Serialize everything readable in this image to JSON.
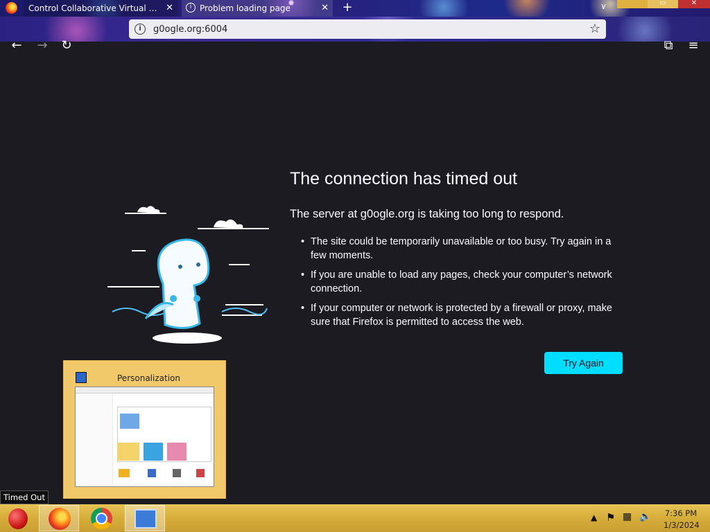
{
  "browser": {
    "tabs": [
      {
        "label": "Control Collaborative Virtual Machine",
        "close": "✕"
      },
      {
        "label": "Problem loading page",
        "close": "✕"
      }
    ],
    "new_tab": "+",
    "url": "g0ogle.org:6004"
  },
  "error": {
    "title": "The connection has timed out",
    "description": "The server at g0ogle.org is taking too long to respond.",
    "items": [
      "The site could be temporarily unavailable or too busy. Try again in a few moments.",
      "If you are unable to load any pages, check your computer’s network connection.",
      "If your computer or network is protected by a firewall or proxy, make sure that Firefox is permitted to access the web."
    ],
    "button": "Try Again"
  },
  "thumbnail": {
    "title": "Personalization"
  },
  "tooltip": "Timed Out",
  "taskbar": {
    "apps": [
      "start-ornament",
      "firefox",
      "chrome",
      "control-panel"
    ],
    "time": "7:36 PM",
    "date": "1/3/2024"
  },
  "colors": {
    "accent_button": "#00ddff",
    "page_bg": "#1c1b22",
    "taskbar": "#d6ad3a"
  }
}
